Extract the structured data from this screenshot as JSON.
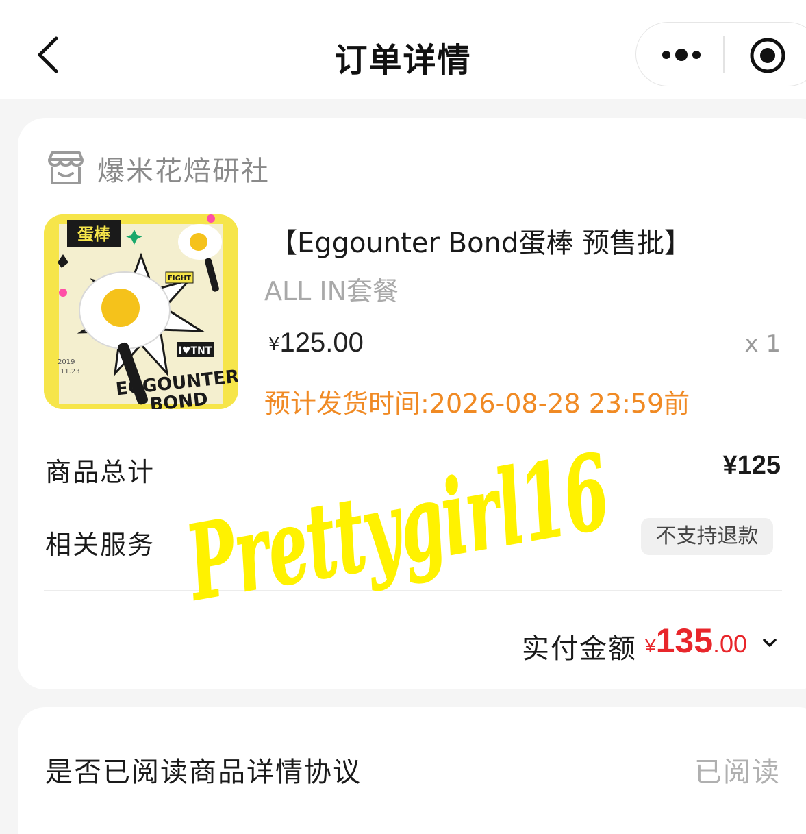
{
  "nav": {
    "title": "订单详情",
    "icons": {
      "back": "chevron-left-icon",
      "more": "more-dots-icon",
      "close": "target-circle-icon"
    }
  },
  "order": {
    "shop_name": "爆米花焙研社",
    "shop_icon": "shop-icon",
    "product": {
      "title": "【Eggounter Bond蛋棒 预售批】",
      "spec": "ALL IN套餐",
      "price_currency": "¥",
      "price": "125.00",
      "quantity": "x 1",
      "ship_time": "预计发货时间:2026-08-28 23:59前",
      "thumbnail_text": {
        "tag": "蛋棒",
        "fight": "FIGHT",
        "tnt": "I♥TNT",
        "date_year": "2019",
        "date_day": "11.23",
        "brand_line1": "EGGOUNTER",
        "brand_line2": "BOND"
      }
    },
    "subtotal_label": "商品总计",
    "subtotal_value": "¥125",
    "service_label": "相关服务",
    "service_tag": "不支持退款",
    "paid_label": "实付金额",
    "paid_currency": "¥",
    "paid_integer": "135",
    "paid_decimal": ".00"
  },
  "agreement": {
    "label": "是否已阅读商品详情协议",
    "status": "已阅读"
  },
  "watermark_text": "Prettygirl16",
  "colors": {
    "accent_price": "#e8262b",
    "ship_time": "#f08a24",
    "watermark": "#fff200",
    "background": "#f5f5f5"
  }
}
